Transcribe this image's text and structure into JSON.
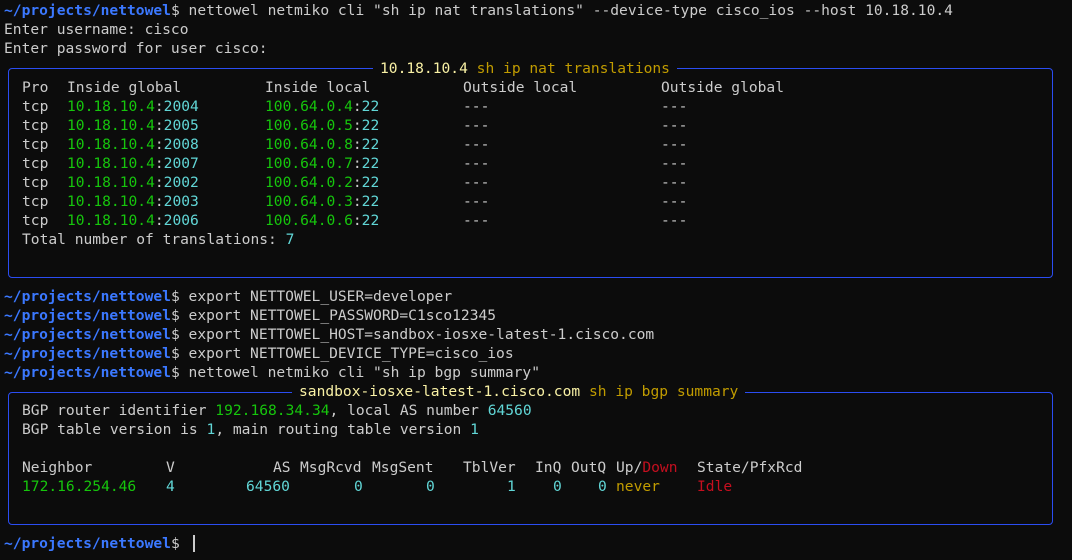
{
  "prompt": {
    "path": "~/projects/nettowel",
    "symbol": "$"
  },
  "session1": {
    "command": "nettowel netmiko cli \"sh ip nat translations\" --device-type cisco_ios --host 10.18.10.4",
    "username_prompt": "Enter username: cisco",
    "password_prompt": "Enter password for user cisco:"
  },
  "nat_panel": {
    "title_host": "10.18.10.4",
    "title_cmd": "sh ip nat translations",
    "headers": [
      "Pro",
      "Inside global",
      "Inside local",
      "Outside local",
      "Outside global"
    ],
    "rows": [
      {
        "pro": "tcp",
        "ig_ip": "10.18.10.4",
        "ig_port": "2004",
        "il_ip": "100.64.0.4",
        "il_port": "22",
        "ol": "---",
        "og": "---"
      },
      {
        "pro": "tcp",
        "ig_ip": "10.18.10.4",
        "ig_port": "2005",
        "il_ip": "100.64.0.5",
        "il_port": "22",
        "ol": "---",
        "og": "---"
      },
      {
        "pro": "tcp",
        "ig_ip": "10.18.10.4",
        "ig_port": "2008",
        "il_ip": "100.64.0.8",
        "il_port": "22",
        "ol": "---",
        "og": "---"
      },
      {
        "pro": "tcp",
        "ig_ip": "10.18.10.4",
        "ig_port": "2007",
        "il_ip": "100.64.0.7",
        "il_port": "22",
        "ol": "---",
        "og": "---"
      },
      {
        "pro": "tcp",
        "ig_ip": "10.18.10.4",
        "ig_port": "2002",
        "il_ip": "100.64.0.2",
        "il_port": "22",
        "ol": "---",
        "og": "---"
      },
      {
        "pro": "tcp",
        "ig_ip": "10.18.10.4",
        "ig_port": "2003",
        "il_ip": "100.64.0.3",
        "il_port": "22",
        "ol": "---",
        "og": "---"
      },
      {
        "pro": "tcp",
        "ig_ip": "10.18.10.4",
        "ig_port": "2006",
        "il_ip": "100.64.0.6",
        "il_port": "22",
        "ol": "---",
        "og": "---"
      }
    ],
    "total_label": "Total number of translations: ",
    "total_value": "7"
  },
  "exports": [
    "export NETTOWEL_USER=developer",
    "export NETTOWEL_PASSWORD=C1sco12345",
    "export NETTOWEL_HOST=sandbox-iosxe-latest-1.cisco.com",
    "export NETTOWEL_DEVICE_TYPE=cisco_ios"
  ],
  "session2": {
    "command": "nettowel netmiko cli \"sh ip bgp summary\""
  },
  "bgp_panel": {
    "title_host": "sandbox-iosxe-latest-1.cisco.com",
    "title_cmd": "sh ip bgp summary",
    "router_id_label": "BGP router identifier ",
    "router_id": "192.168.34.34",
    "local_as_label": ", local AS number ",
    "local_as": "64560",
    "table_version_label": "BGP table version is ",
    "table_version": "1",
    "main_table_label": ", main routing table version ",
    "main_table_version": "1",
    "headers": {
      "neighbor": "Neighbor",
      "v": "V",
      "as": "AS",
      "msgrcvd": "MsgRcvd",
      "msgsent": "MsgSent",
      "tblver": "TblVer",
      "inq": "InQ",
      "outq": "OutQ",
      "up": "Up/",
      "down": "Down",
      "state": "State/PfxRcd"
    },
    "row": {
      "neighbor": "172.16.254.46",
      "v": "4",
      "as": "64560",
      "msgrcvd": "0",
      "msgsent": "0",
      "tblver": "1",
      "inq": "0",
      "outq": "0",
      "updown": "never",
      "state": "Idle"
    }
  },
  "colors": {
    "background": "#0c0c0c",
    "prompt_path": "#3b78ff",
    "panel_border": "#2b4df2",
    "ip_green": "#16c60c",
    "number_cyan": "#61d6d6",
    "title_yellow": "#f9f1a5",
    "title_gold": "#c19c00",
    "down_red": "#c50f1f"
  }
}
